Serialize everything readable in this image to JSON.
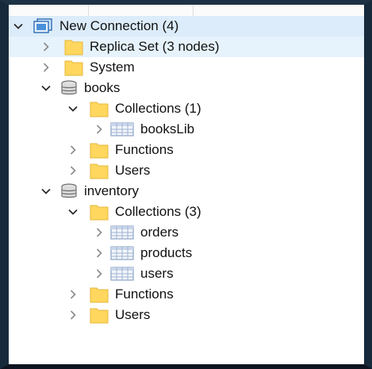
{
  "tree": {
    "connection": {
      "label": "New Connection (4)"
    },
    "replica_set": {
      "label": "Replica Set (3 nodes)"
    },
    "system": {
      "label": "System"
    },
    "books": {
      "label": "books",
      "collections": {
        "label": "Collections (1)"
      },
      "items": [
        {
          "label": "booksLib"
        }
      ],
      "functions": {
        "label": "Functions"
      },
      "users": {
        "label": "Users"
      }
    },
    "inventory": {
      "label": "inventory",
      "collections": {
        "label": "Collections (3)"
      },
      "items": [
        {
          "label": "orders"
        },
        {
          "label": "products"
        },
        {
          "label": "users"
        }
      ],
      "functions": {
        "label": "Functions"
      },
      "users": {
        "label": "Users"
      }
    }
  },
  "colors": {
    "frame": "#162a3c",
    "selection_bg": "#e6f3fd",
    "folder": "#ffd75e",
    "chevron": "#8a8a8a",
    "chevron_expanded": "#2b2b2b"
  }
}
